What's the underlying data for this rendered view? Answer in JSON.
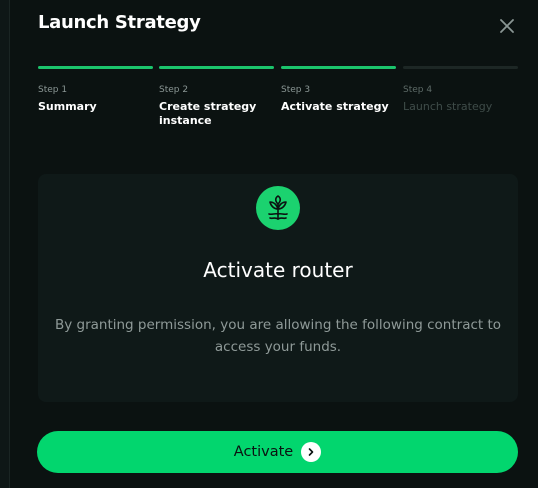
{
  "modal": {
    "title": "Launch Strategy"
  },
  "steps": [
    {
      "number": "Step 1",
      "label": "Summary",
      "status": "done"
    },
    {
      "number": "Step 2",
      "label": "Create strategy instance",
      "status": "done"
    },
    {
      "number": "Step 3",
      "label": "Activate strategy",
      "status": "done"
    },
    {
      "number": "Step 4",
      "label": "Launch strategy",
      "status": "pending"
    }
  ],
  "card": {
    "icon": "router-sprout-icon",
    "title": "Activate router",
    "description": "By granting permission, you are allowing the following contract to access your funds."
  },
  "action": {
    "label": "Activate",
    "icon": "chevron-right-icon"
  },
  "colors": {
    "background": "#0b1211",
    "card": "#0f1918",
    "accent": "#02d66e",
    "muted_text": "#8f9a98"
  }
}
